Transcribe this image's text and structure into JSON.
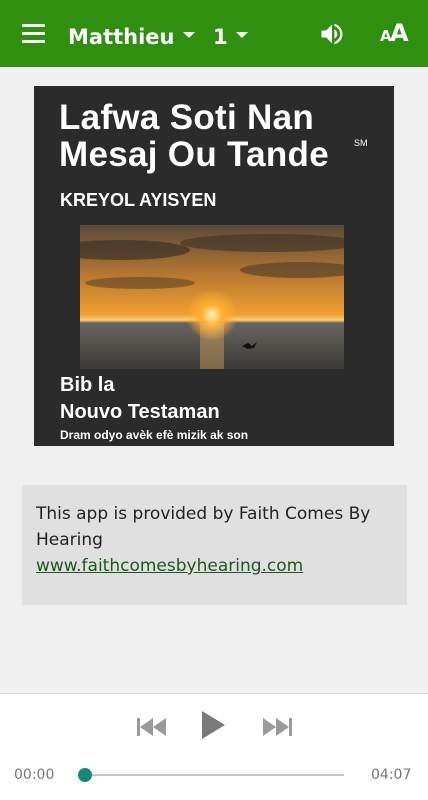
{
  "appbar": {
    "book": "Matthieu",
    "chapter": "1",
    "icons": {
      "menu": "menu-icon",
      "volume": "volume-icon",
      "font_size": "font-size-icon"
    },
    "font_icon_small": "A",
    "font_icon_large": "A",
    "color": "#2f8f0e"
  },
  "cover": {
    "title_line1": "Lafwa Soti Nan",
    "title_line2": "Mesaj Ou Tande",
    "service_mark": "SM",
    "language": "KREYOL AYISYEN",
    "line_bible": "Bib la",
    "line_nt": "Nouvo Testaman",
    "line_drama": "Dram odyo avèk efè mizik ak son"
  },
  "info": {
    "text": "This app is provided by Faith Comes By Hearing",
    "link": "www.faithcomesbyhearing.com"
  },
  "player": {
    "current_time": "00:00",
    "total_time": "04:07",
    "progress": 0,
    "accent": "#138a76"
  }
}
